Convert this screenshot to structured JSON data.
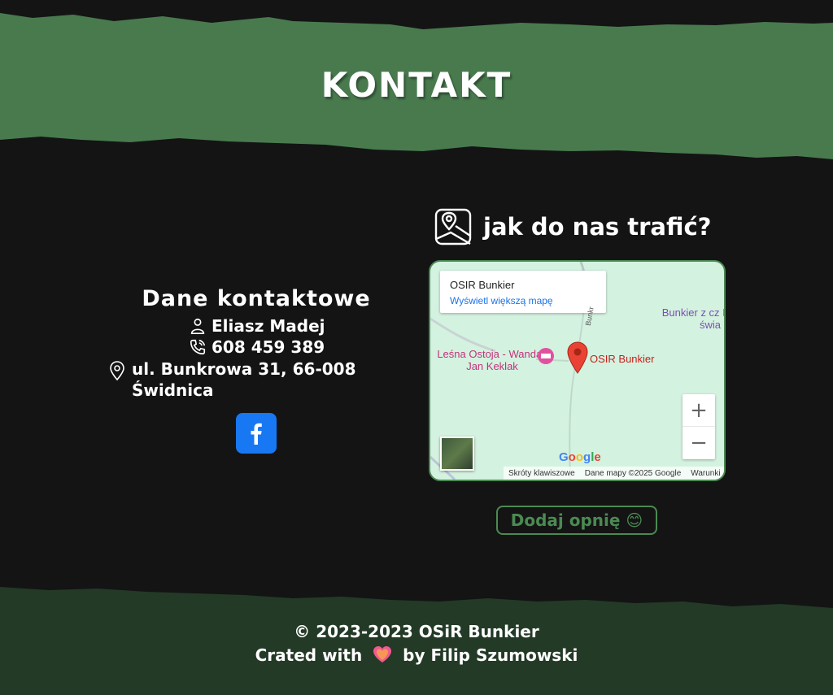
{
  "header": {
    "title": "KONTAKT",
    "band_color": "#487a4e"
  },
  "contact": {
    "heading": "Dane kontaktowe",
    "name": "Eliasz Madej",
    "phone": "608 459 389",
    "address_line1": "ul. Bunkrowa 31, 66-008",
    "address_line2": "Świdnica",
    "facebook_icon": "facebook-icon",
    "facebook_color": "#1877f2"
  },
  "directions": {
    "heading": "jak do nas trafić?",
    "icon": "map-pin-icon"
  },
  "map": {
    "card_title": "OSIR Bunkier",
    "card_link": "Wyświetl większą mapę",
    "place_1": "Leśna Ostoja - Wanda i Jan Keklak",
    "place_2": "OSIR Bunkier",
    "place_3": "Bunkier z cz II wojny świa",
    "road": "Bunkr",
    "zoom_in": "+",
    "zoom_out": "−",
    "google": "Google",
    "footer_shortcuts": "Skróty klawiszowe",
    "footer_data": "Dane mapy ©2025 Google",
    "footer_terms": "Warunki"
  },
  "review": {
    "label": "Dodaj opnię 😊",
    "color": "#4b8a52"
  },
  "footer": {
    "copyright": "© 2023-2023 OSiR Bunkier",
    "credit_prefix": "Crated with",
    "credit_suffix": "by Filip Szumowski",
    "band_color": "#233a26"
  }
}
